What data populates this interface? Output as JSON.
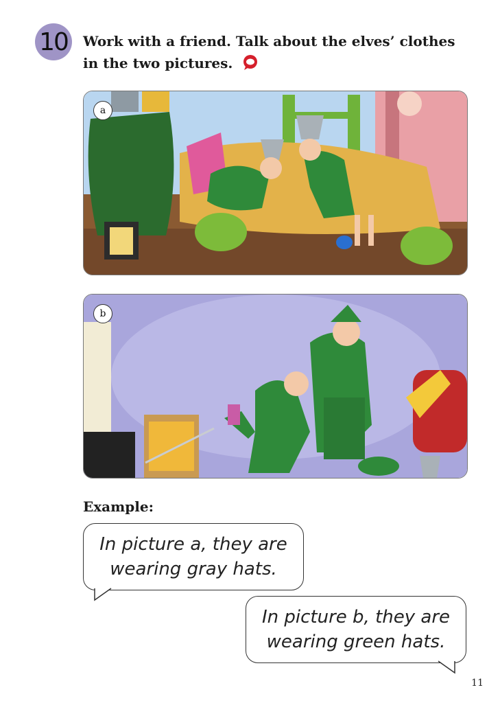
{
  "exercise": {
    "number": "10",
    "instruction_line1": "Work with a friend. Talk about the elves’ clothes",
    "instruction_line2": "in the two pictures."
  },
  "pictures": [
    {
      "label": "a"
    },
    {
      "label": "b"
    }
  ],
  "example": {
    "heading": "Example:",
    "bubble1": {
      "line1": "In picture a, they are",
      "line2": "wearing gray hats."
    },
    "bubble2": {
      "line1": "In picture b, they are",
      "line2": "wearing green hats."
    }
  },
  "page_number": "11",
  "colors": {
    "badge": "#9f94c6",
    "speak_icon": "#d51f2b",
    "elf_green": "#2f8a3a",
    "wall_a": "#b9d6f0",
    "wall_b": "#a9a6dc"
  }
}
